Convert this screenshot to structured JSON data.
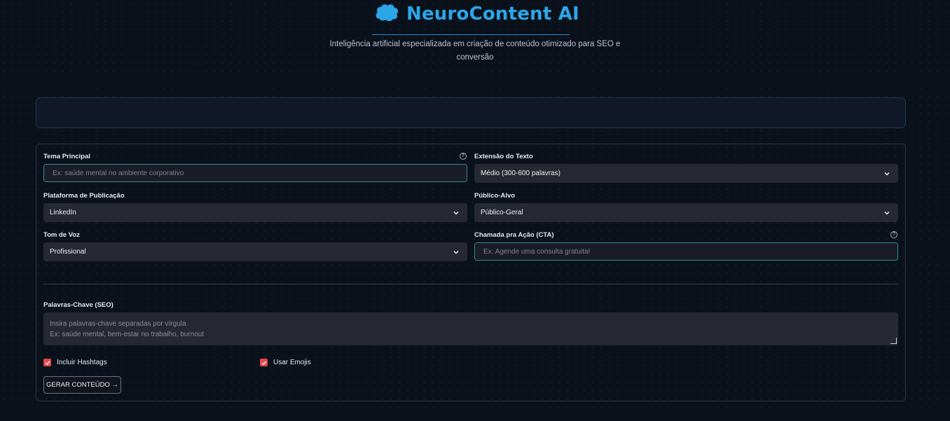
{
  "header": {
    "brand_icon": "brain-icon",
    "title": "NeuroContent AI",
    "subtitle": "Inteligência artificial especializada em criação de conteúdo otimizado para SEO e conversão"
  },
  "form": {
    "tema": {
      "label": "Tema Principal",
      "placeholder": "Ex: saúde mental no ambiente corporativo"
    },
    "extensao": {
      "label": "Extensão do Texto",
      "value": "Médio (300-600 palavras)"
    },
    "plataforma": {
      "label": "Plataforma de Publicação",
      "value": "LinkedIn"
    },
    "publico": {
      "label": "Público-Alvo",
      "value": "Público-Geral"
    },
    "tom": {
      "label": "Tom de Voz",
      "value": "Profissional"
    },
    "cta": {
      "label": "Chamada pra Ação (CTA)",
      "placeholder": "Ex: Agende uma consulta gratuita!"
    },
    "keywords": {
      "label": "Palavras-Chave (SEO)",
      "placeholder_line1": "Insira palavras-chave separadas por vírgula",
      "placeholder_line2": "Ex: saúde mental, bem-estar no trabalho, burnout"
    },
    "hashtags": {
      "label": "Incluir Hashtags",
      "checked": true
    },
    "emojis": {
      "label": "Usar Emojis",
      "checked": true
    },
    "submit_label": "GERAR CONTEÚDO →"
  },
  "colors": {
    "accent": "#2ba6e8",
    "checkbox": "#e6474d",
    "background": "#0b111b"
  }
}
